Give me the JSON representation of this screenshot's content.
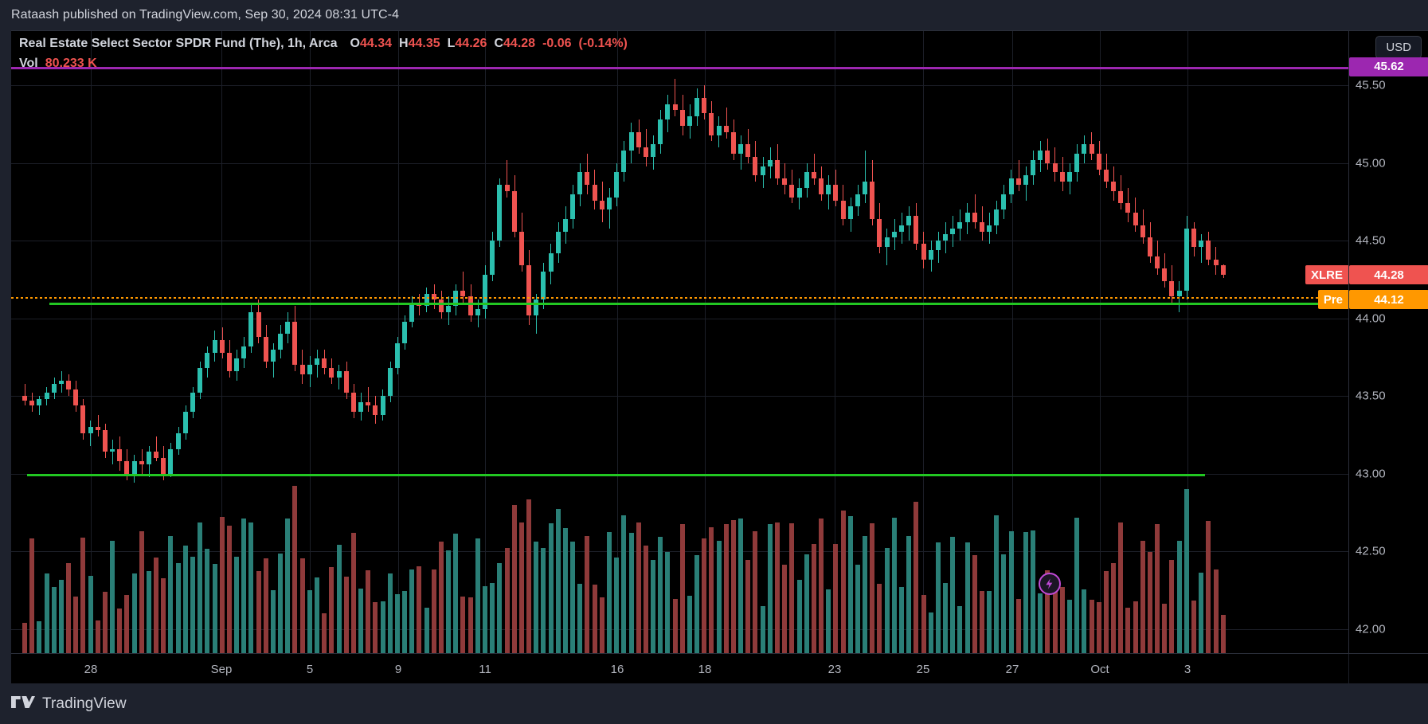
{
  "published": {
    "text": "Rataash published on TradingView.com, Sep 30, 2024 08:31 UTC-4"
  },
  "legend": {
    "title": "Real Estate Select Sector SPDR Fund (The), 1h, Arca",
    "o_label": "O",
    "o_value": "44.34",
    "h_label": "H",
    "h_value": "44.35",
    "l_label": "L",
    "l_value": "44.26",
    "c_label": "C",
    "c_value": "44.28",
    "change": "-0.06",
    "change_pct": "(-0.14%)",
    "vol_label": "Vol",
    "vol_value": "80.233 K"
  },
  "price_scale": {
    "currency_button": "USD",
    "ticks": [
      "45.50",
      "45.00",
      "44.50",
      "44.00",
      "43.50",
      "43.00",
      "42.50",
      "42.00"
    ],
    "badges": [
      {
        "name": "resistance-level-badge",
        "text": "45.62",
        "bg": "#9c27b0"
      },
      {
        "name": "last-price-badge",
        "text": "44.28",
        "bg": "#ef5350",
        "tag": "XLRE",
        "tag_bg": "#ef5350"
      },
      {
        "name": "premarket-price-badge",
        "text": "44.12",
        "bg": "#ff9800",
        "tag": "Pre",
        "tag_bg": "#ff9800"
      }
    ]
  },
  "time_scale": {
    "ticks": [
      "28",
      "Sep",
      "5",
      "9",
      "11",
      "16",
      "18",
      "23",
      "25",
      "27",
      "Oct",
      "3"
    ]
  },
  "footer": {
    "brand": "TradingView"
  },
  "colors": {
    "up": "#2bbfae",
    "down": "#ef5350",
    "support_line": "#22c722",
    "resistance_line": "#9c27b0",
    "premarket_line": "#ff9800",
    "background": "#000000",
    "chrome": "#1e222d",
    "text": "#d1d4dc"
  },
  "overlays": {
    "lightning_badge": "lightning-bolt-icon"
  },
  "chart_data": {
    "type": "candlestick",
    "title": "Real Estate Select Sector SPDR Fund (The), 1h, Arca",
    "symbol": "XLRE",
    "interval": "1h",
    "exchange": "Arca",
    "currency": "USD",
    "xlabel": "",
    "ylabel": "",
    "ylim": [
      41.85,
      45.85
    ],
    "xtick_labels": [
      "28",
      "Sep",
      "5",
      "9",
      "11",
      "16",
      "18",
      "23",
      "25",
      "27",
      "Oct",
      "3"
    ],
    "ytick_labels": [
      "45.50",
      "45.00",
      "44.50",
      "44.00",
      "43.50",
      "43.00",
      "42.50",
      "42.00"
    ],
    "grid": true,
    "legend": "none",
    "horizontal_lines": [
      {
        "label": "45.62",
        "value": 45.62,
        "color": "#9c27b0",
        "style": "solid"
      },
      {
        "label": "44.12",
        "value": 44.12,
        "color": "#ff9800",
        "style": "dotted"
      },
      {
        "label": "44.10",
        "value": 44.1,
        "color": "#22c722",
        "style": "solid"
      },
      {
        "label": "43.00",
        "value": 43.0,
        "color": "#22c722",
        "style": "solid"
      }
    ],
    "last_price": 44.28,
    "premarket_price": 44.12,
    "ohlc_current": {
      "open": 44.34,
      "high": 44.35,
      "low": 44.26,
      "close": 44.28
    },
    "change": -0.06,
    "change_pct": -0.14,
    "volume_last": "80.233 K",
    "candles": [
      [
        43.5,
        43.58,
        43.44,
        43.47
      ],
      [
        43.47,
        43.52,
        43.4,
        43.44
      ],
      [
        43.44,
        43.5,
        43.38,
        43.48
      ],
      [
        43.48,
        43.56,
        43.44,
        43.52
      ],
      [
        43.52,
        43.62,
        43.48,
        43.58
      ],
      [
        43.58,
        43.66,
        43.52,
        43.6
      ],
      [
        43.6,
        43.64,
        43.5,
        43.54
      ],
      [
        43.54,
        43.6,
        43.4,
        43.44
      ],
      [
        43.44,
        43.48,
        43.22,
        43.26
      ],
      [
        43.26,
        43.34,
        43.18,
        43.3
      ],
      [
        43.3,
        43.38,
        43.24,
        43.28
      ],
      [
        43.28,
        43.32,
        43.1,
        43.14
      ],
      [
        43.14,
        43.22,
        43.06,
        43.16
      ],
      [
        43.16,
        43.24,
        43.02,
        43.08
      ],
      [
        43.08,
        43.16,
        42.96,
        43.0
      ],
      [
        43.0,
        43.12,
        42.94,
        43.08
      ],
      [
        43.08,
        43.16,
        43.0,
        43.06
      ],
      [
        43.06,
        43.18,
        42.98,
        43.14
      ],
      [
        43.14,
        43.24,
        43.08,
        43.1
      ],
      [
        43.1,
        43.18,
        42.96,
        43.0
      ],
      [
        43.0,
        43.2,
        42.98,
        43.16
      ],
      [
        43.16,
        43.3,
        43.12,
        43.26
      ],
      [
        43.26,
        43.44,
        43.22,
        43.4
      ],
      [
        43.4,
        43.56,
        43.36,
        43.52
      ],
      [
        43.52,
        43.72,
        43.48,
        43.68
      ],
      [
        43.68,
        43.82,
        43.62,
        43.78
      ],
      [
        43.78,
        43.92,
        43.72,
        43.86
      ],
      [
        43.86,
        43.94,
        43.74,
        43.78
      ],
      [
        43.78,
        43.86,
        43.62,
        43.66
      ],
      [
        43.66,
        43.8,
        43.6,
        43.74
      ],
      [
        43.74,
        43.88,
        43.68,
        43.82
      ],
      [
        43.82,
        44.1,
        43.78,
        44.04
      ],
      [
        44.04,
        44.12,
        43.84,
        43.88
      ],
      [
        43.88,
        43.96,
        43.68,
        43.72
      ],
      [
        43.72,
        43.84,
        43.62,
        43.8
      ],
      [
        43.8,
        43.96,
        43.74,
        43.9
      ],
      [
        43.9,
        44.04,
        43.84,
        43.98
      ],
      [
        43.98,
        44.08,
        43.66,
        43.7
      ],
      [
        43.7,
        43.8,
        43.58,
        43.64
      ],
      [
        43.64,
        43.76,
        43.56,
        43.7
      ],
      [
        43.7,
        43.8,
        43.62,
        43.74
      ],
      [
        43.74,
        43.8,
        43.64,
        43.68
      ],
      [
        43.68,
        43.74,
        43.58,
        43.62
      ],
      [
        43.62,
        43.7,
        43.54,
        43.66
      ],
      [
        43.66,
        43.72,
        43.48,
        43.52
      ],
      [
        43.52,
        43.58,
        43.36,
        43.4
      ],
      [
        43.4,
        43.52,
        43.34,
        43.46
      ],
      [
        43.46,
        43.56,
        43.4,
        43.44
      ],
      [
        43.44,
        43.5,
        43.32,
        43.38
      ],
      [
        43.38,
        43.54,
        43.34,
        43.5
      ],
      [
        43.5,
        43.72,
        43.46,
        43.68
      ],
      [
        43.68,
        43.88,
        43.64,
        43.84
      ],
      [
        43.84,
        44.02,
        43.8,
        43.98
      ],
      [
        43.98,
        44.14,
        43.94,
        44.1
      ],
      [
        44.1,
        44.16,
        44.02,
        44.08
      ],
      [
        44.08,
        44.2,
        44.04,
        44.16
      ],
      [
        44.16,
        44.22,
        44.06,
        44.12
      ],
      [
        44.12,
        44.18,
        44.0,
        44.04
      ],
      [
        44.04,
        44.14,
        43.96,
        44.08
      ],
      [
        44.08,
        44.22,
        44.02,
        44.18
      ],
      [
        44.18,
        44.3,
        44.1,
        44.14
      ],
      [
        44.14,
        44.22,
        43.98,
        44.02
      ],
      [
        44.02,
        44.12,
        43.94,
        44.06
      ],
      [
        44.06,
        44.34,
        44.0,
        44.28
      ],
      [
        44.28,
        44.56,
        44.24,
        44.5
      ],
      [
        44.5,
        44.9,
        44.46,
        44.86
      ],
      [
        44.86,
        45.02,
        44.78,
        44.82
      ],
      [
        44.82,
        44.92,
        44.52,
        44.56
      ],
      [
        44.56,
        44.68,
        44.3,
        44.34
      ],
      [
        44.34,
        44.44,
        43.96,
        44.02
      ],
      [
        44.02,
        44.16,
        43.9,
        44.12
      ],
      [
        44.12,
        44.36,
        44.06,
        44.3
      ],
      [
        44.3,
        44.48,
        44.22,
        44.42
      ],
      [
        44.42,
        44.62,
        44.36,
        44.56
      ],
      [
        44.56,
        44.72,
        44.48,
        44.64
      ],
      [
        44.64,
        44.86,
        44.58,
        44.8
      ],
      [
        44.8,
        45.0,
        44.72,
        44.94
      ],
      [
        44.94,
        45.06,
        44.8,
        44.86
      ],
      [
        44.86,
        44.96,
        44.7,
        44.76
      ],
      [
        44.76,
        44.88,
        44.62,
        44.7
      ],
      [
        44.7,
        44.84,
        44.58,
        44.78
      ],
      [
        44.78,
        45.0,
        44.72,
        44.94
      ],
      [
        44.94,
        45.14,
        44.88,
        45.08
      ],
      [
        45.08,
        45.26,
        45.0,
        45.2
      ],
      [
        45.2,
        45.28,
        45.06,
        45.1
      ],
      [
        45.1,
        45.22,
        44.98,
        45.04
      ],
      [
        45.04,
        45.18,
        44.96,
        45.12
      ],
      [
        45.12,
        45.34,
        45.06,
        45.28
      ],
      [
        45.28,
        45.44,
        45.2,
        45.38
      ],
      [
        45.38,
        45.54,
        45.3,
        45.34
      ],
      [
        45.34,
        45.44,
        45.18,
        45.24
      ],
      [
        45.24,
        45.38,
        45.16,
        45.3
      ],
      [
        45.3,
        45.48,
        45.24,
        45.42
      ],
      [
        45.42,
        45.5,
        45.28,
        45.32
      ],
      [
        45.32,
        45.4,
        45.14,
        45.18
      ],
      [
        45.18,
        45.3,
        45.1,
        45.24
      ],
      [
        45.24,
        45.36,
        45.16,
        45.2
      ],
      [
        45.2,
        45.28,
        45.02,
        45.06
      ],
      [
        45.06,
        45.18,
        44.96,
        45.12
      ],
      [
        45.12,
        45.22,
        45.0,
        45.04
      ],
      [
        45.04,
        45.14,
        44.88,
        44.92
      ],
      [
        44.92,
        45.04,
        44.84,
        44.98
      ],
      [
        44.98,
        45.1,
        44.9,
        45.02
      ],
      [
        45.02,
        45.12,
        44.86,
        44.9
      ],
      [
        44.9,
        45.0,
        44.8,
        44.86
      ],
      [
        44.86,
        44.96,
        44.74,
        44.78
      ],
      [
        44.78,
        44.9,
        44.7,
        44.84
      ],
      [
        44.84,
        45.0,
        44.78,
        44.94
      ],
      [
        44.94,
        45.06,
        44.86,
        44.9
      ],
      [
        44.9,
        44.98,
        44.76,
        44.8
      ],
      [
        44.8,
        44.92,
        44.7,
        44.86
      ],
      [
        44.86,
        44.96,
        44.72,
        44.76
      ],
      [
        44.76,
        44.86,
        44.6,
        44.64
      ],
      [
        44.64,
        44.78,
        44.56,
        44.72
      ],
      [
        44.72,
        44.86,
        44.66,
        44.8
      ],
      [
        44.8,
        45.08,
        44.74,
        44.88
      ],
      [
        44.88,
        45.02,
        44.6,
        44.64
      ],
      [
        44.64,
        44.74,
        44.42,
        44.46
      ],
      [
        44.46,
        44.58,
        44.34,
        44.52
      ],
      [
        44.52,
        44.64,
        44.44,
        44.56
      ],
      [
        44.56,
        44.68,
        44.48,
        44.6
      ],
      [
        44.6,
        44.72,
        44.5,
        44.66
      ],
      [
        44.66,
        44.74,
        44.44,
        44.48
      ],
      [
        44.48,
        44.56,
        44.32,
        44.38
      ],
      [
        44.38,
        44.5,
        44.3,
        44.44
      ],
      [
        44.44,
        44.56,
        44.36,
        44.5
      ],
      [
        44.5,
        44.62,
        44.42,
        44.54
      ],
      [
        44.54,
        44.66,
        44.46,
        44.58
      ],
      [
        44.58,
        44.7,
        44.5,
        44.62
      ],
      [
        44.62,
        44.74,
        44.54,
        44.68
      ],
      [
        44.68,
        44.8,
        44.58,
        44.62
      ],
      [
        44.62,
        44.72,
        44.5,
        44.56
      ],
      [
        44.56,
        44.68,
        44.48,
        44.6
      ],
      [
        44.6,
        44.76,
        44.54,
        44.7
      ],
      [
        44.7,
        44.86,
        44.64,
        44.8
      ],
      [
        44.8,
        44.96,
        44.74,
        44.9
      ],
      [
        44.9,
        45.02,
        44.82,
        44.86
      ],
      [
        44.86,
        44.98,
        44.76,
        44.92
      ],
      [
        44.92,
        45.08,
        44.86,
        45.02
      ],
      [
        45.02,
        45.14,
        44.94,
        45.08
      ],
      [
        45.08,
        45.16,
        44.96,
        45.0
      ],
      [
        45.0,
        45.1,
        44.88,
        44.94
      ],
      [
        44.94,
        45.04,
        44.82,
        44.88
      ],
      [
        44.88,
        45.0,
        44.8,
        44.94
      ],
      [
        44.94,
        45.12,
        44.88,
        45.06
      ],
      [
        45.06,
        45.18,
        45.0,
        45.12
      ],
      [
        45.12,
        45.2,
        45.02,
        45.06
      ],
      [
        45.06,
        45.14,
        44.92,
        44.96
      ],
      [
        44.96,
        45.06,
        44.84,
        44.88
      ],
      [
        44.88,
        44.98,
        44.76,
        44.82
      ],
      [
        44.82,
        44.92,
        44.7,
        44.74
      ],
      [
        44.74,
        44.84,
        44.62,
        44.68
      ],
      [
        44.68,
        44.78,
        44.56,
        44.6
      ],
      [
        44.6,
        44.7,
        44.48,
        44.52
      ],
      [
        44.52,
        44.62,
        44.36,
        44.4
      ],
      [
        44.4,
        44.5,
        44.28,
        44.32
      ],
      [
        44.32,
        44.42,
        44.2,
        44.24
      ],
      [
        44.24,
        44.34,
        44.1,
        44.14
      ],
      [
        44.14,
        44.24,
        44.04,
        44.18
      ],
      [
        44.18,
        44.66,
        44.12,
        44.58
      ],
      [
        44.58,
        44.62,
        44.4,
        44.46
      ],
      [
        44.46,
        44.54,
        44.36,
        44.5
      ],
      [
        44.5,
        44.56,
        44.34,
        44.38
      ],
      [
        44.38,
        44.46,
        44.28,
        44.34
      ],
      [
        44.34,
        44.35,
        44.26,
        44.28
      ]
    ]
  }
}
